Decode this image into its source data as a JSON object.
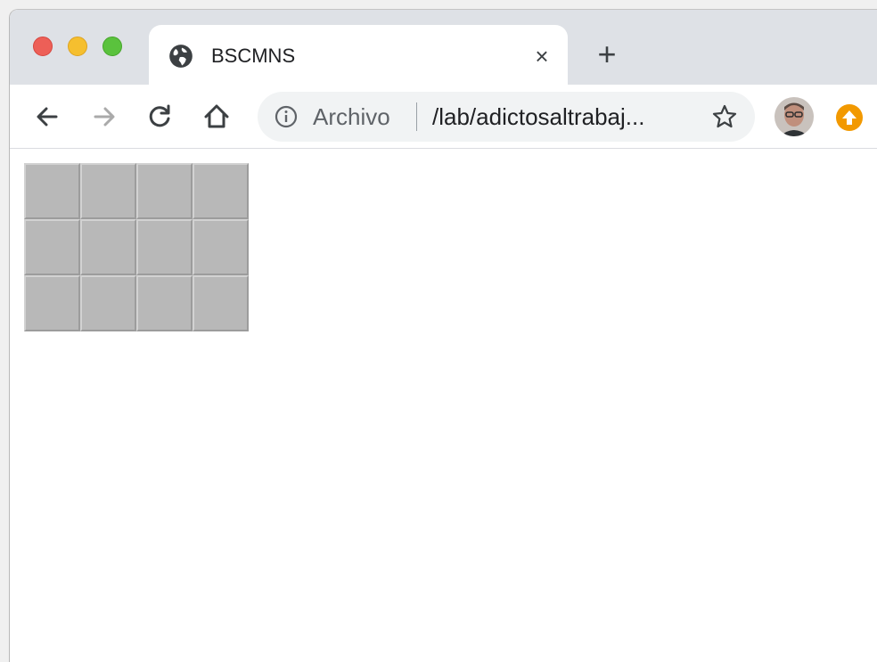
{
  "tab": {
    "title": "BSCMNS",
    "favicon": "globe-icon",
    "close_glyph": "×"
  },
  "tabstrip": {
    "new_tab_glyph": "+"
  },
  "toolbar": {
    "back": "arrow-left-icon",
    "forward": "arrow-right-icon",
    "reload": "reload-icon",
    "home": "home-icon"
  },
  "omnibox": {
    "security_label": "Archivo",
    "url": "/lab/adictosaltrabaj...",
    "bookmark": "star-icon"
  },
  "extension": {
    "icon": "upload-arrow-icon",
    "color": "#f29900"
  },
  "page": {
    "grid": {
      "rows": 3,
      "cols": 4,
      "cell_color": "#b8b8b8"
    }
  }
}
